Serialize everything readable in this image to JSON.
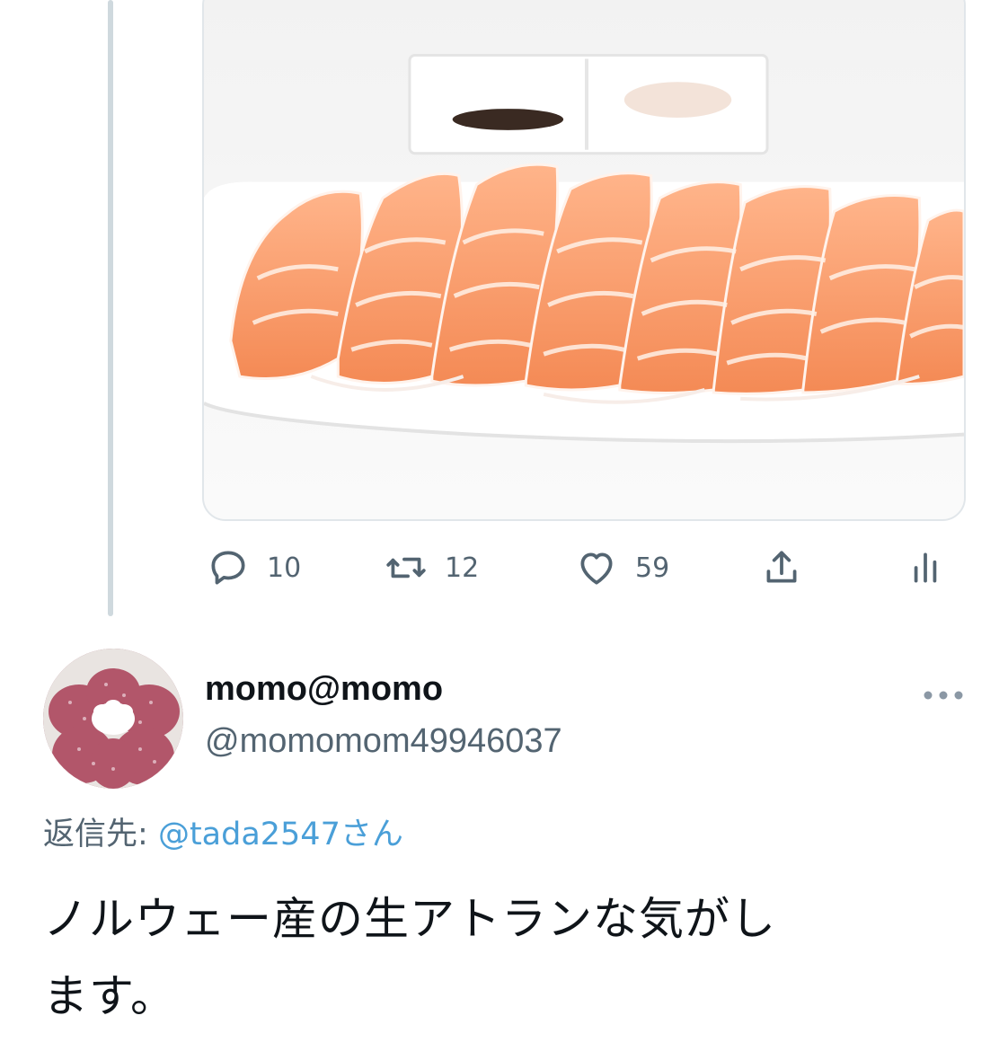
{
  "tweet_actions": {
    "reply_count": "10",
    "retweet_count": "12",
    "like_count": "59"
  },
  "reply_tweet": {
    "display_name": "momo@momo",
    "handle": "@momomom49946037",
    "reply_prefix": "返信先:",
    "reply_mention": "@tada2547さん",
    "body_line1": "ノルウェー産の生アトランな気がし",
    "body_line2": "ます。"
  },
  "colors": {
    "text_primary": "#0f1419",
    "text_secondary": "#536471",
    "mention": "#4a9fd8",
    "thread_line": "#cfd9de"
  },
  "icons": [
    "reply-icon",
    "retweet-icon",
    "like-icon",
    "share-icon",
    "stats-icon",
    "more-options-icon"
  ]
}
